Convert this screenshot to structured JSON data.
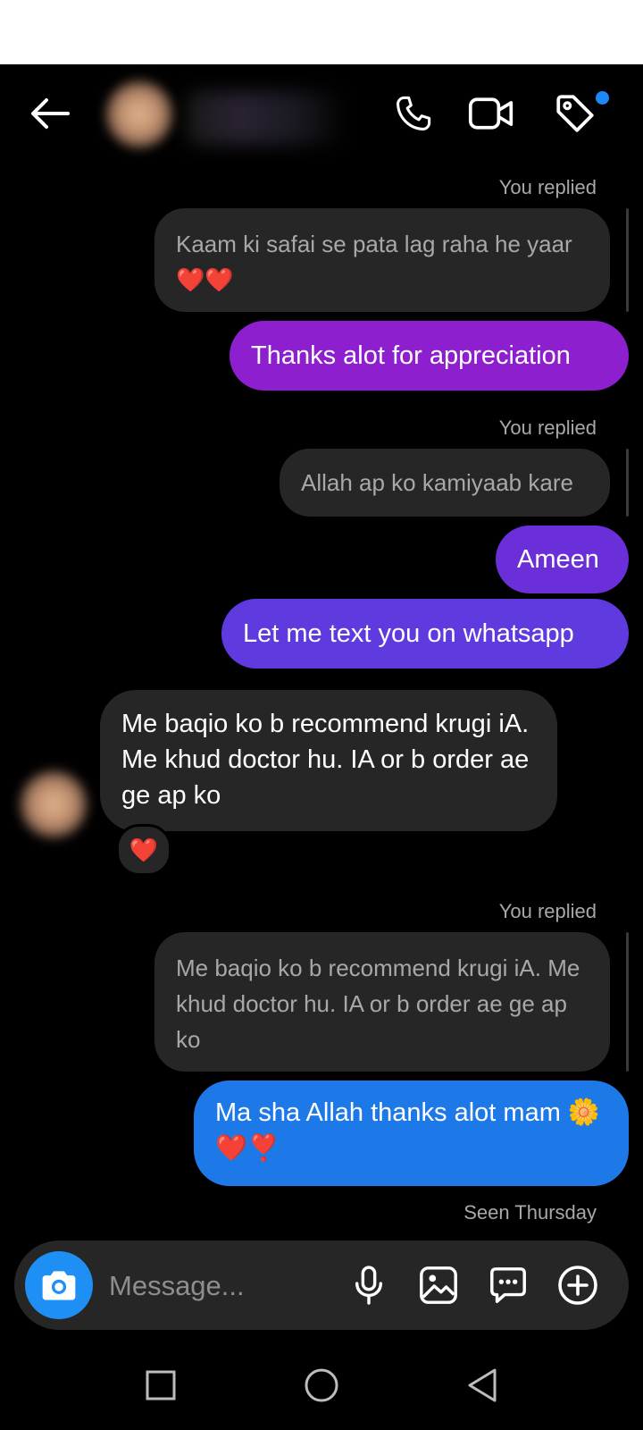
{
  "header": {
    "back_icon": "arrow-left-icon",
    "call_icon": "phone-icon",
    "video_icon": "video-camera-icon",
    "tag_icon": "tag-icon",
    "notification_dot_color": "#1e88f5"
  },
  "messages": [
    {
      "type": "reply_label",
      "text": "You replied"
    },
    {
      "type": "quoted",
      "text": "Kaam ki safai se pata lag raha he yaar❤️❤️"
    },
    {
      "type": "sent",
      "text": "Thanks alot for appreciation",
      "color": "#8e1fcf"
    },
    {
      "type": "reply_label",
      "text": "You replied"
    },
    {
      "type": "quoted",
      "text": "Allah ap ko kamiyaab kare"
    },
    {
      "type": "sent",
      "text": "Ameen",
      "color": "#6b2fd9"
    },
    {
      "type": "sent",
      "text": "Let me text you on whatsapp",
      "color": "#5e3adf"
    },
    {
      "type": "received",
      "text": "Me baqio ko b recommend krugi iA. Me khud doctor hu. IA or b order ae ge ap ko",
      "reaction": "❤️"
    },
    {
      "type": "reply_label",
      "text": "You replied"
    },
    {
      "type": "quoted",
      "text": "Me baqio ko b recommend krugi iA. Me khud doctor hu. IA or b order ae ge ap ko"
    },
    {
      "type": "sent",
      "text": "Ma sha Allah thanks alot mam 🌼❤️❣️",
      "color": "#1e79e8"
    },
    {
      "type": "status",
      "text": "Seen Thursday"
    }
  ],
  "composer": {
    "placeholder": "Message...",
    "camera_icon": "camera-icon",
    "mic_icon": "microphone-icon",
    "gallery_icon": "image-icon",
    "sticker_icon": "chat-sticker-icon",
    "more_icon": "plus-circle-icon",
    "camera_button_color": "#1e8ff5"
  },
  "navbar": {
    "recents_icon": "square-icon",
    "home_icon": "circle-icon",
    "back_icon": "triangle-back-icon"
  }
}
